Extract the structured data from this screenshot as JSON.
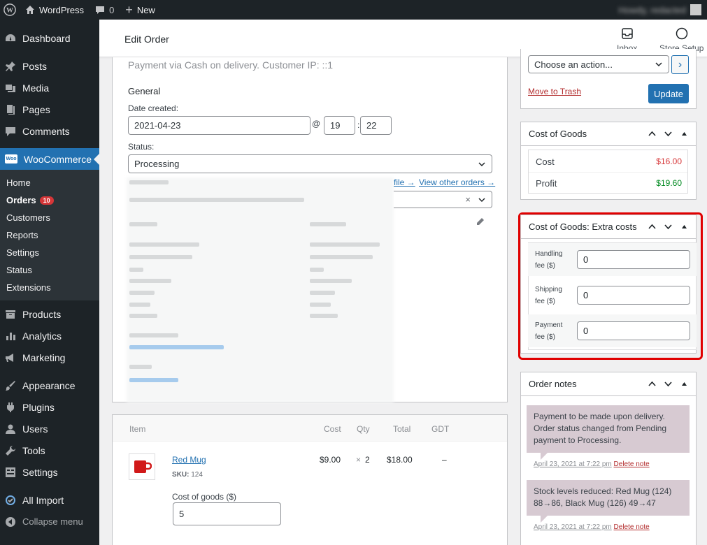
{
  "adminbar": {
    "site": "WordPress",
    "comments": "0",
    "new": "New",
    "user": "Howdy, redacted"
  },
  "sidebar": {
    "items_top": [
      {
        "label": "Dashboard",
        "icon": "dashboard-icon"
      },
      {
        "label": "Posts",
        "icon": "pin-icon"
      },
      {
        "label": "Media",
        "icon": "media-icon"
      },
      {
        "label": "Pages",
        "icon": "pages-icon"
      },
      {
        "label": "Comments",
        "icon": "comment-icon"
      }
    ],
    "woocommerce": "WooCommerce",
    "woo_icon": "Woo",
    "sub": [
      "Home",
      "Orders",
      "Customers",
      "Reports",
      "Settings",
      "Status",
      "Extensions"
    ],
    "orders_badge": "10",
    "items_bottom": [
      "Products",
      "Analytics",
      "Marketing",
      "Appearance",
      "Plugins",
      "Users",
      "Tools",
      "Settings",
      "All Import"
    ],
    "collapse": "Collapse menu"
  },
  "topbar": {
    "title": "Edit Order",
    "inbox": "Inbox",
    "store_setup": "Store Setup"
  },
  "order": {
    "payment_line": "Payment via Cash on delivery. Customer IP: ::1",
    "general": "General",
    "date_created_label": "Date created:",
    "date": "2021-04-23",
    "at": "@",
    "hour": "19",
    "colon": ":",
    "minute": "22",
    "status_label": "Status:",
    "status": "Processing",
    "profile_link": "file →",
    "view_orders_link": "View other orders →",
    "clear": "×",
    "billing": "Billing",
    "shipping": "Shipping"
  },
  "items": {
    "headers": {
      "item": "Item",
      "cost": "Cost",
      "qty": "Qty",
      "total": "Total",
      "gdt": "GDT"
    },
    "rows": [
      {
        "name": "Red Mug",
        "sku_label": "SKU:",
        "sku": "124",
        "cost": "$9.00",
        "x": "×",
        "qty": "2",
        "total": "$18.00",
        "gdt": "–"
      }
    ],
    "cog_label": "Cost of goods ($)",
    "cog_value": "5"
  },
  "actions": {
    "choose": "Choose an action...",
    "go": "›",
    "trash": "Move to Trash",
    "update": "Update"
  },
  "cog_box": {
    "title": "Cost of Goods",
    "cost_label": "Cost",
    "cost_value": "$16.00",
    "profit_label": "Profit",
    "profit_value": "$19.60"
  },
  "extra_box": {
    "title": "Cost of Goods: Extra costs",
    "fees": [
      {
        "label1": "Handling",
        "label2": "fee ($)",
        "value": "0"
      },
      {
        "label1": "Shipping",
        "label2": "fee ($)",
        "value": "0"
      },
      {
        "label1": "Payment",
        "label2": "fee ($)",
        "value": "0"
      }
    ]
  },
  "notes_box": {
    "title": "Order notes",
    "notes": [
      {
        "text": "Payment to be made upon delivery. Order status changed from Pending payment to Processing.",
        "date": "April 23, 2021 at 7:22 pm",
        "del": "Delete note"
      },
      {
        "text": "Stock levels reduced: Red Mug (124) 88→86, Black Mug (126) 49→47",
        "date": "April 23, 2021 at 7:22 pm",
        "del": "Delete note"
      }
    ]
  },
  "colors": {
    "accent": "#2271b1",
    "highlight": "#e00000",
    "cost": "#d63638",
    "profit": "#008a20"
  }
}
